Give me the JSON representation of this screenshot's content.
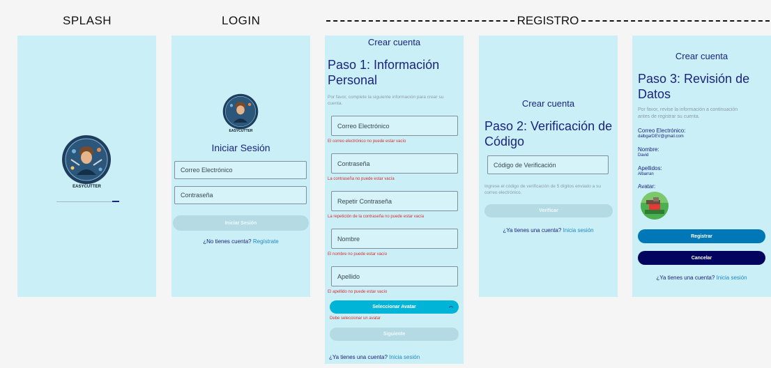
{
  "headers": {
    "splash": "SPLASH",
    "login": "LOGIN",
    "registro": "REGISTRO"
  },
  "brand": {
    "name": "EASYCUTTER"
  },
  "login": {
    "title": "Iniciar Sesión",
    "email_placeholder": "Correo Electrónico",
    "password_placeholder": "Contraseña",
    "submit_label": "Iniciar Sesión",
    "no_account": "¿No tienes cuenta?",
    "register_link": "Regístrate"
  },
  "step1": {
    "screen_title": "Crear cuenta",
    "step_title_line1": "Paso 1: Información",
    "step_title_line2": "Personal",
    "instructions_line1": "Por favor, complete la siguiente información para crear su",
    "instructions_line2": "cuenta.",
    "email_label": "Correo Electrónico",
    "email_error": "El correo electrónico no puede estar vacío",
    "password_label": "Contraseña",
    "password_error": "La contraseña no puede estar vacía",
    "repeat_label": "Repetir Contraseña",
    "repeat_error": "La repetición de la contraseña no puede estar vacía",
    "name_label": "Nombre",
    "name_error": "El nombre no puede estar vacío",
    "surname_label": "Apellido",
    "surname_error": "El apellido no puede estar vacío",
    "avatar_button": "Seleccionar Avatar",
    "avatar_error": "Debe seleccionar un avatar",
    "next_button": "Siguiente",
    "have_account": "¿Ya tienes una cuenta?",
    "login_link": "Inicia sesión"
  },
  "step2": {
    "screen_title": "Crear cuenta",
    "step_title_line1": "Paso 2: Verificación de",
    "step_title_line2": "Código",
    "code_label": "Código de Verificación",
    "instructions_line1": "Ingrese el código de verificación de 5 dígitos enviado a su",
    "instructions_line2": "correo electrónico.",
    "verify_button": "Verificar",
    "have_account": "¿Ya tienes una cuenta?",
    "login_link": "Inicia sesión"
  },
  "step3": {
    "screen_title": "Crear cuenta",
    "step_title_line1": "Paso 3: Revisión de",
    "step_title_line2": "Datos",
    "instructions_line1": "Por favor, revise la información a continuación",
    "instructions_line2": "antes de registrar su cuenta.",
    "email_label": "Correo Electrónico:",
    "email_value": "dalbgarDEV@gmail.com",
    "name_label": "Nombre:",
    "name_value": "David",
    "surname_label": "Apellidos:",
    "surname_value": "Albarran",
    "avatar_label": "Avatar:",
    "register_button": "Registrar",
    "cancel_button": "Cancelar",
    "have_account": "¿Ya tienes una cuenta?",
    "login_link": "Inicia sesión"
  },
  "colors": {
    "screen_bg": "#cbeff7",
    "title": "#1a237e",
    "accent_cyan": "#00b4d8",
    "register_blue": "#0077b6",
    "cancel_navy": "#03045e",
    "disabled": "#b4dbe3",
    "error": "#d32f2f",
    "link": "#1e88c8"
  }
}
